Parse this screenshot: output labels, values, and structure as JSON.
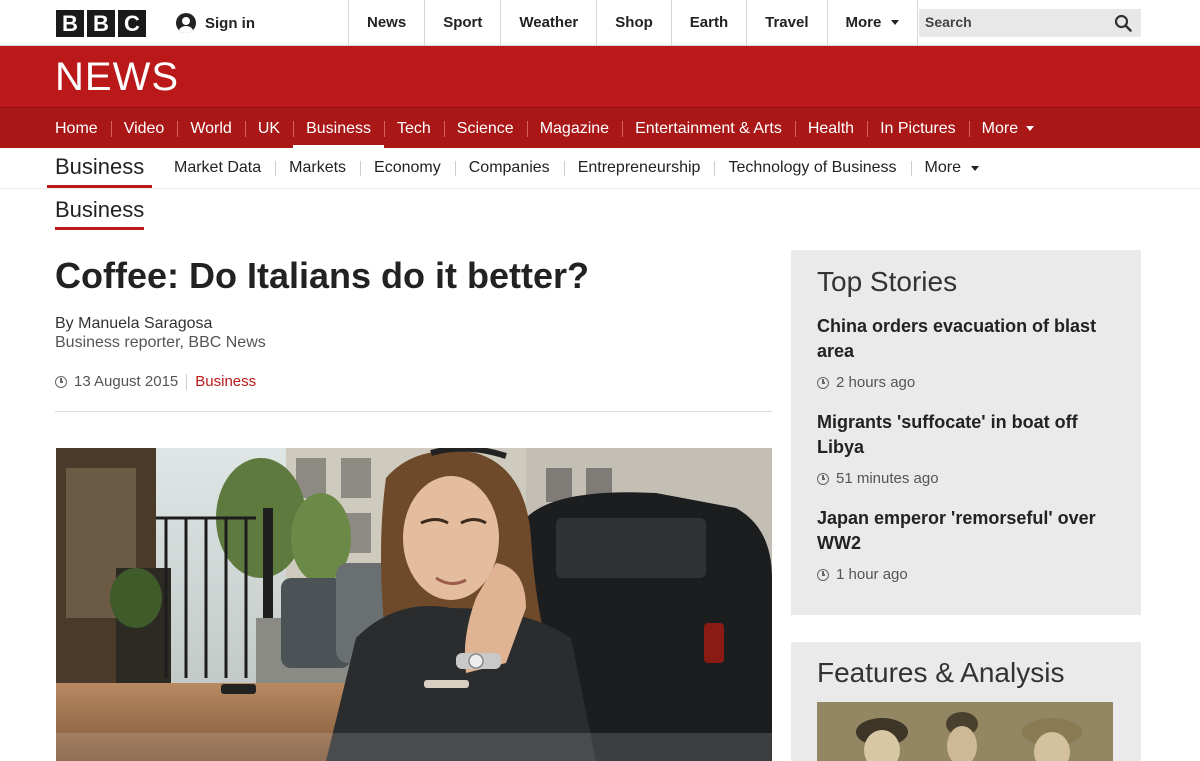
{
  "brand": {
    "logo_letters": [
      "B",
      "B",
      "C"
    ],
    "signin_label": "Sign in"
  },
  "top_nav": [
    "News",
    "Sport",
    "Weather",
    "Shop",
    "Earth",
    "Travel",
    "More"
  ],
  "search": {
    "placeholder": "Search"
  },
  "masthead": {
    "title": "NEWS"
  },
  "section_nav": [
    "Home",
    "Video",
    "World",
    "UK",
    "Business",
    "Tech",
    "Science",
    "Magazine",
    "Entertainment & Arts",
    "Health",
    "In Pictures",
    "More"
  ],
  "section_nav_active": "Business",
  "sub_nav": {
    "label": "Business",
    "items": [
      "Market Data",
      "Markets",
      "Economy",
      "Companies",
      "Entrepreneurship",
      "Technology of Business",
      "More"
    ]
  },
  "page_section_label": "Business",
  "article": {
    "headline": "Coffee: Do Italians do it better?",
    "author": "By Manuela Saragosa",
    "author_role": "Business reporter, BBC News",
    "date": "13 August 2015",
    "tag": "Business"
  },
  "top_stories": {
    "title": "Top Stories",
    "items": [
      {
        "title": "China orders evacuation of blast area",
        "time": "2 hours ago"
      },
      {
        "title": "Migrants 'suffocate' in boat off Libya",
        "time": "51 minutes ago"
      },
      {
        "title": "Japan emperor 'remorseful' over WW2",
        "time": "1 hour ago"
      }
    ]
  },
  "features": {
    "title": "Features & Analysis"
  },
  "colors": {
    "brand_red": "#bb1919",
    "nav_red": "#a91717",
    "sidebar_bg": "#eaeaea"
  }
}
